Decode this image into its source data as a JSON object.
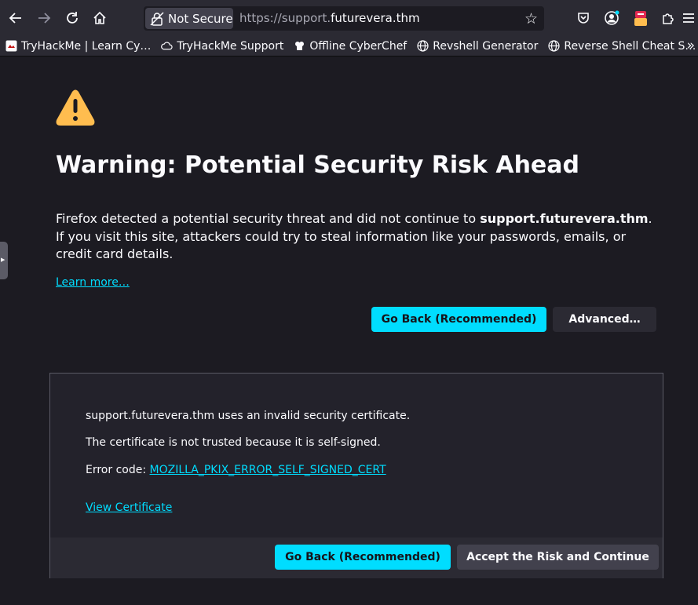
{
  "browser": {
    "not_secure_label": "Not Secure",
    "url_prefix": "https://support.",
    "url_domain": "futurevera.thm"
  },
  "bookmarks": [
    {
      "label": "TryHackMe | Learn Cy…",
      "icon": "tryhackme-favicon-icon"
    },
    {
      "label": "TryHackMe Support",
      "icon": "cloud-icon"
    },
    {
      "label": "Offline CyberChef",
      "icon": "chef-hat-icon"
    },
    {
      "label": "Revshell Generator",
      "icon": "globe-icon"
    },
    {
      "label": "Reverse Shell Cheat S…",
      "icon": "globe-icon"
    }
  ],
  "bookmarks_overflow": "»",
  "page": {
    "title": "Warning: Potential Security Risk Ahead",
    "desc_before": "Firefox detected a potential security threat and did not continue to ",
    "desc_host": "support.futurevera.thm",
    "desc_after": ". If you visit this site, attackers could try to steal information like your passwords, emails, or credit card details.",
    "learn_more": "Learn more…",
    "go_back": "Go Back (Recommended)",
    "advanced": "Advanced…"
  },
  "advanced_panel": {
    "line1": "support.futurevera.thm uses an invalid security certificate.",
    "line2": "The certificate is not trusted because it is self-signed.",
    "error_label": "Error code: ",
    "error_code": "MOZILLA_PKIX_ERROR_SELF_SIGNED_CERT",
    "view_certificate": "View Certificate",
    "go_back": "Go Back (Recommended)",
    "accept": "Accept the Risk and Continue"
  },
  "colors": {
    "accent": "#00ddff",
    "warning": "#ffbd4f",
    "background": "#1c1b22"
  }
}
